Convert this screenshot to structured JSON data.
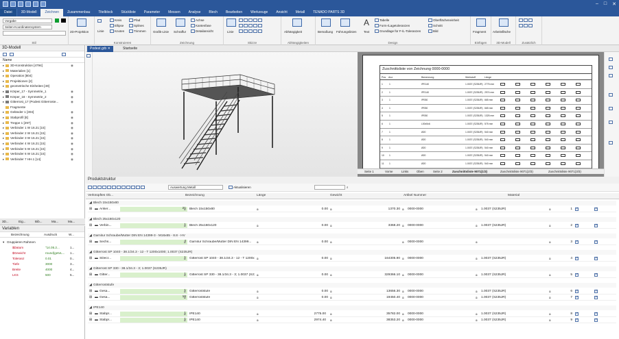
{
  "tabs": [
    "Datei",
    "3D-Modell",
    "Zeichnen",
    "Zusammenbau",
    "Titelblock",
    "Stückliste",
    "Parameter",
    "Messen",
    "Analyse",
    "Blech",
    "Bearbeiten",
    "Werkzeuge",
    "Ansicht",
    "Metall",
    "TENADO PARTS 3D"
  ],
  "ribbon": {
    "stil_combo1": "Vorgabe",
    "stil_combo2": "Seiten-Koordinatensystem",
    "stil_label": "Stil",
    "projektion": "2D-Projektion",
    "konstruieren": {
      "linie": "Linie",
      "kreis": "Kreis",
      "ellipse": "Ellipse",
      "knoten": "Knoten",
      "pfad": "Pfad",
      "splines": "Splines",
      "trimmen": "Trimmen",
      "label": "Konstruieren"
    },
    "zeichnung": {
      "grafiklinie": "Grafik-Linie",
      "schraffur": "Schraffur",
      "achse": "Achse",
      "kantenfase": "Kantenfase",
      "detailansicht": "Detailansicht",
      "label": "Zeichnung"
    },
    "skizze": {
      "linie": "Linie",
      "label": "Skizze"
    },
    "abhaengigkeiten": {
      "abhaengigkeit": "Abhängigkeit",
      "label": "Abhängigkeiten"
    },
    "design": {
      "bemassung": "Bemaßung",
      "fuehrungslinien": "Führungslinien",
      "text": "Text",
      "tabelle": "Tabelle",
      "form": "Form-/Lagetoleranzen",
      "grundlage": "Grundlage für F-/L-Toleranzen",
      "oberflaeche": "Oberflächeneinheit",
      "schnitt": "Schnitt",
      "bild": "Bild",
      "label": "Design"
    },
    "einfuegen": {
      "fragment": "Fragment",
      "label": "Einfügen"
    },
    "modell3d": {
      "arbeitsflaeche": "Arbeitsfläche",
      "label": "3D-Modell"
    },
    "zusaetzlich": {
      "label": "Zusätzlich"
    }
  },
  "leftpanel": {
    "title": "3D-Modell",
    "col": "Name",
    "items": [
      "3D-Konstruktion [4794]",
      "Materialien [1]",
      "Operation [804]",
      "Projektionen [2]",
      "geometrische Einheiten [49]",
      "Körper_17 - Symmetrie_1",
      "Körper_18 - Symmetrie_2",
      "Gitterrost_17 (Podest Gitterroste...",
      "Fragmente",
      "Geländer 1 [304]",
      "Stabprofil [8]",
      "Treppe 1 [297]",
      "Verbinder 1 W 16.21 [15]",
      "Verbinder 2 W 16.21 [15]",
      "Verbinder 3 W 16.21 [15]",
      "Verbinder 4 W 16.21 [15]",
      "Verbinder 5 W 16.21 [15]",
      "Verbinder 6 W 16.21 [15]",
      "Verbinder 7 HH.1 [14]"
    ]
  },
  "doctabs": {
    "active": "Podest.grb",
    "start": "Startseite"
  },
  "sheet": {
    "title": "Zuschnittsliste von Zeichnung 0000-0000",
    "cols": [
      "Pos",
      "Anz",
      "Benennung",
      "Werkstoff",
      "Länge"
    ],
    "rows": [
      [
        "1",
        "1",
        "IPE140",
        "1.0037 (S235JR)",
        "2775 mm"
      ],
      [
        "2",
        "1",
        "IPE140",
        "1.0037 (S235JR)",
        "2974 mm"
      ],
      [
        "3",
        "1",
        "IPE80",
        "1.0037 (S235JR)",
        "665 mm"
      ],
      [
        "4",
        "1",
        "IPE80",
        "1.0037 (S235JR)",
        "665 mm"
      ],
      [
        "5",
        "1",
        "IPE80",
        "1.0037 (S235JR)",
        "1325 mm"
      ],
      [
        "6",
        "1",
        "L50x5x6",
        "1.0037 (S235JR)",
        "575 mm"
      ],
      [
        "7",
        "1",
        "Ø20",
        "1.0037 (S235JR)",
        "540 mm"
      ],
      [
        "8",
        "1",
        "Ø20",
        "1.0037 (S235JR)",
        "540 mm"
      ],
      [
        "9",
        "1",
        "Ø20",
        "1.0037 (S235JR)",
        "540 mm"
      ],
      [
        "10",
        "1",
        "Ø20",
        "1.0037 (S235JR)",
        "540 mm"
      ],
      [
        "11",
        "1",
        "Ø20",
        "1.0037 (S235JR)",
        "540 mm"
      ]
    ],
    "tabs": [
      "Seite 1",
      "Vorne",
      "Links",
      "Oben",
      "Seite 2",
      "Zuschnittsliste 9071(1/3)",
      "Zuschnittsliste 9071(2/3)",
      "Zuschnittsliste 9071(3/3)"
    ]
  },
  "ps": {
    "title": "Produktstruktur",
    "auswertung": "Auswertung Metall",
    "aktualisieren": "Aktualisieren",
    "headers": [
      "Verknüpftes Ob...",
      "Bezeichnung",
      "Länge",
      "Gewicht",
      "Artikel Nummer",
      "Material"
    ],
    "groups": [
      {
        "title": "Blech 15x150x80",
        "rows": [
          {
            "obj": "Anker...",
            "count": "21",
            "bez": "Blech 15x150x80",
            "len": "",
            "gew": "0.00",
            "gew2": "1370.30",
            "art": "0000-0000",
            "mat": "1.0037 (S235JR)",
            "pos": "1"
          }
        ]
      },
      {
        "title": "Blech 25x160x120",
        "rows": [
          {
            "obj": "Verbin...",
            "count": "1",
            "bez": "Blech 25x160x120",
            "len": "",
            "gew": "0.00",
            "gew2": "3368.20",
            "art": "0000-0000",
            "mat": "1.0037 (S235JR)",
            "pos": "2"
          }
        ]
      },
      {
        "title": "Garnitur Schraube/Mutter DIN EN 14399-3 - M16x65 - 8.8 - HV",
        "rows": [
          {
            "obj": "Sechs...",
            "count": "4",
            "bez": "Garnitur Schraube/Mutter DIN EN 14399...",
            "len": "",
            "gew": "0.00",
            "gew2": "",
            "art": "0000-0000",
            "mat": "",
            "pos": "3"
          }
        ]
      },
      {
        "title": "Gitterrost SP 1040 - 38.1/34.3 - 12 - T 1200x1000; 1.0037 (S235JR)",
        "rows": [
          {
            "obj": "SDecr...",
            "count": "1",
            "bez": "Gitterrost SP 1040 - 38.1/34.3 - 12 - T 1200x1000; 1.0037 (S235JR)",
            "len": "",
            "gew": "0.00",
            "gew2": "164305.90",
            "art": "0000-0000",
            "mat": "1.0037 (S235JR)",
            "pos": "4"
          }
        ]
      },
      {
        "title": "Gitterrost SP 330 - 38.1/34.3 - 3; 1.0037 (S235JR)",
        "rows": [
          {
            "obj": "Gitter...",
            "count": "1",
            "bez": "Gitterrost SP 330 - 38.1/34.3 - 3; 1.0037 (S23...",
            "len": "",
            "gew": "0.00",
            "gew2": "329366.10",
            "art": "0000-0000",
            "mat": "1.0037 (S235JR)",
            "pos": "5"
          }
        ]
      },
      {
        "title": "Gitterroststufe",
        "rows": [
          {
            "obj": "Gesa...",
            "count": "1",
            "bez": "Gitterroststufe",
            "len": "",
            "gew": "0.00",
            "gew2": "13656.30",
            "art": "0000-0000",
            "mat": "1.0037 (S235JR)",
            "pos": "6"
          },
          {
            "obj": "Gesa...",
            "count": "16",
            "bez": "Gitterroststufe",
            "len": "",
            "gew": "0.00",
            "gew2": "19450.40",
            "art": "0000-0000",
            "mat": "1.0037 (S235JR)",
            "pos": "7"
          }
        ]
      },
      {
        "title": "IPE140",
        "rows": [
          {
            "obj": "Stabpr...",
            "count": "1",
            "bez": "IPE140",
            "len": "2775.00",
            "gew": "",
            "gew2": "35782.00",
            "art": "0000-0000",
            "mat": "1.0037 (S235JR)",
            "pos": "8"
          },
          {
            "obj": "Stabpr...",
            "count": "1",
            "bez": "IPE140",
            "len": "2974.40",
            "gew": "",
            "gew2": "38353.20",
            "art": "0000-0000",
            "mat": "1.0037 (S235JR)",
            "pos": "9"
          }
        ]
      }
    ]
  },
  "variables": {
    "tabs": [
      "3D...",
      "Eig...",
      "Bib...",
      "Ma...",
      "Ma..."
    ],
    "title": "Variablen",
    "headers": [
      "Bezeichnung",
      "Ausdruck",
      "W..."
    ],
    "group": "Gruppieren Rahmen",
    "rows": [
      [
        "$Datum",
        "\"14.05.2...",
        "1..."
      ],
      [
        "$Gewicht",
        "round(getvL...",
        "1..."
      ],
      [
        "Toleranz",
        "0.01",
        "0..."
      ],
      [
        "Tiefe",
        "3000",
        "3..."
      ],
      [
        "Breite",
        "4000",
        "4..."
      ],
      [
        "LKS",
        "500",
        "5..."
      ]
    ]
  }
}
